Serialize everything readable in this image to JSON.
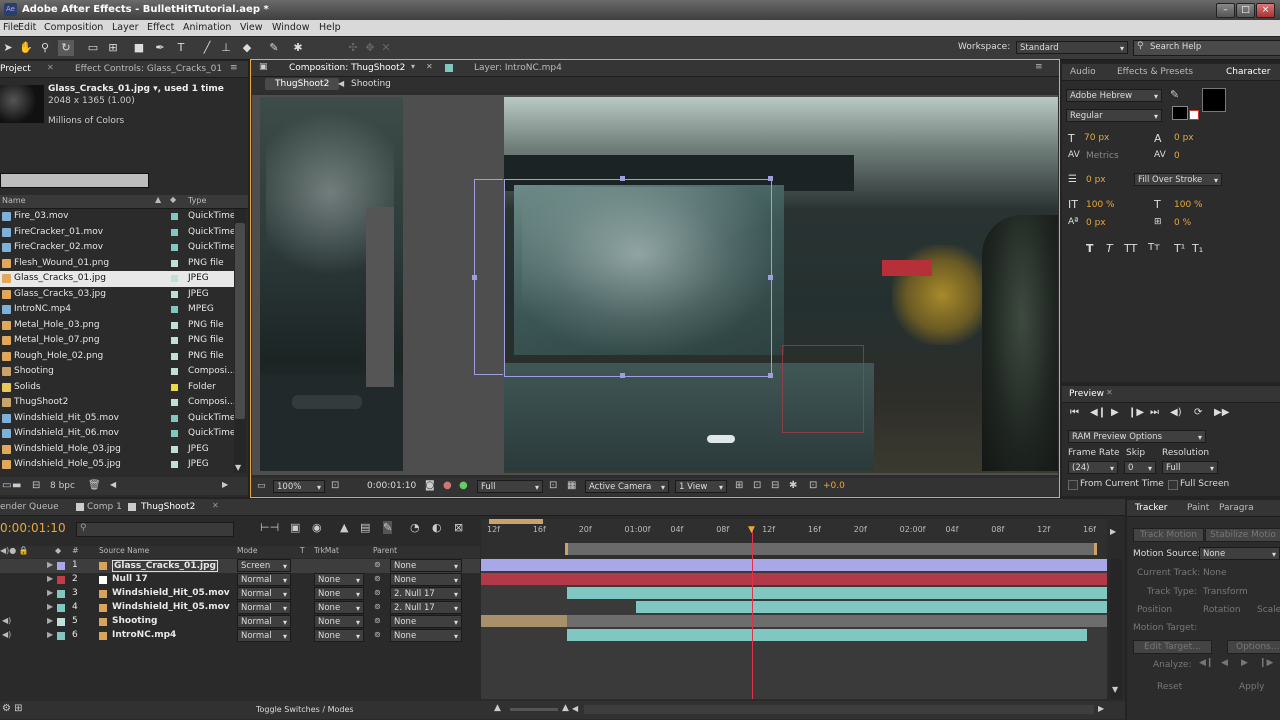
{
  "window": {
    "title": "Adobe After Effects - BulletHitTutorial.aep *"
  },
  "menu": [
    "File",
    "Edit",
    "Composition",
    "Layer",
    "Effect",
    "Animation",
    "View",
    "Window",
    "Help"
  ],
  "toolbar": {
    "workspace_label": "Workspace:",
    "workspace_value": "Standard",
    "search_placeholder": "Search Help"
  },
  "project": {
    "tab_project": "Project",
    "tab_effects": "Effect Controls: Glass_Cracks_01",
    "preview_name": "Glass_Cracks_01.jpg ▾, used 1 time",
    "preview_dims": "2048 x 1365 (1.00)",
    "preview_colors": "Millions of Colors",
    "col_name": "Name",
    "col_type": "Type",
    "items": [
      {
        "name": "Fire_03.mov",
        "type": "QuickTime",
        "color": "#7fc7c0",
        "icon": "#7fb0d8"
      },
      {
        "name": "FireCracker_01.mov",
        "type": "QuickTime",
        "color": "#7fc7c0",
        "icon": "#7fb0d8"
      },
      {
        "name": "FireCracker_02.mov",
        "type": "QuickTime",
        "color": "#7fc7c0",
        "icon": "#7fb0d8"
      },
      {
        "name": "Flesh_Wound_01.png",
        "type": "PNG file",
        "color": "#bfe0da",
        "icon": "#e0a85c"
      },
      {
        "name": "Glass_Cracks_01.jpg",
        "type": "JPEG",
        "color": "#bfe0da",
        "icon": "#e0a85c",
        "selected": true
      },
      {
        "name": "Glass_Cracks_03.jpg",
        "type": "JPEG",
        "color": "#bfe0da",
        "icon": "#e0a85c"
      },
      {
        "name": "IntroNC.mp4",
        "type": "MPEG",
        "color": "#7fc7c0",
        "icon": "#7fb0d8"
      },
      {
        "name": "Metal_Hole_03.png",
        "type": "PNG file",
        "color": "#bfe0da",
        "icon": "#e0a85c"
      },
      {
        "name": "Metal_Hole_07.png",
        "type": "PNG file",
        "color": "#bfe0da",
        "icon": "#e0a85c"
      },
      {
        "name": "Rough_Hole_02.png",
        "type": "PNG file",
        "color": "#bfe0da",
        "icon": "#e0a85c"
      },
      {
        "name": "Shooting",
        "type": "Composi...",
        "color": "#bfe0da",
        "icon": "#c9a36a"
      },
      {
        "name": "Solids",
        "type": "Folder",
        "color": "#e8d84a",
        "icon": "#e8c85a"
      },
      {
        "name": "ThugShoot2",
        "type": "Composi...",
        "color": "#bfe0da",
        "icon": "#c9a36a"
      },
      {
        "name": "Windshield_Hit_05.mov",
        "type": "QuickTime",
        "color": "#7fc7c0",
        "icon": "#7fb0d8"
      },
      {
        "name": "Windshield_Hit_06.mov",
        "type": "QuickTime",
        "color": "#7fc7c0",
        "icon": "#7fb0d8"
      },
      {
        "name": "Windshield_Hole_03.jpg",
        "type": "JPEG",
        "color": "#bfe0da",
        "icon": "#e0a85c"
      },
      {
        "name": "Windshield_Hole_05.jpg",
        "type": "JPEG",
        "color": "#bfe0da",
        "icon": "#e0a85c"
      }
    ],
    "bpc": "8 bpc"
  },
  "comp": {
    "tab_comp": "Composition: ThugShoot2",
    "tab_layer": "Layer: IntroNC.mp4",
    "nav_current": "ThugShoot2",
    "nav_next": "Shooting",
    "zoom": "100%",
    "timecode": "0:00:01:10",
    "resolution": "Full",
    "camera": "Active Camera",
    "view": "1 View",
    "exposure": "+0.0"
  },
  "character": {
    "tab_audio": "Audio",
    "tab_effects": "Effects & Presets",
    "tab_char": "Character",
    "font": "Adobe Hebrew",
    "style": "Regular",
    "size": "70 px",
    "leading": "0 px",
    "kerning": "Metrics",
    "tracking": "0",
    "stroke_width": "0 px",
    "stroke_mode": "Fill Over Stroke",
    "v_scale": "100 %",
    "h_scale": "100 %",
    "baseline": "0 px",
    "tsume": "0 %"
  },
  "preview": {
    "tab": "Preview",
    "ram_options": "RAM Preview Options",
    "frame_rate_label": "Frame Rate",
    "skip_label": "Skip",
    "resolution_label": "Resolution",
    "frame_rate": "(24)",
    "skip": "0",
    "resolution": "Full",
    "from_current": "From Current Time",
    "full_screen": "Full Screen"
  },
  "timeline": {
    "tab_render": "ender Queue",
    "tab_comp1": "Comp 1",
    "tab_thug": "ThugShoot2",
    "timecode": "0:00:01:10",
    "col_source": "Source Name",
    "col_mode": "Mode",
    "col_t": "T",
    "col_trkmat": "TrkMat",
    "col_parent": "Parent",
    "ruler": [
      "12f",
      "16f",
      "20f",
      "01:00f",
      "04f",
      "08f",
      "12f",
      "16f",
      "20f",
      "02:00f",
      "04f",
      "08f",
      "12f",
      "16f"
    ],
    "layers": [
      {
        "num": "1",
        "name": "Glass_Cracks_01.jpg",
        "mode": "Screen",
        "trkmat": "",
        "parent": "None",
        "label": "#a8a8e8"
      },
      {
        "num": "2",
        "name": "Null 17",
        "mode": "Normal",
        "trkmat": "None",
        "parent": "None",
        "label": "#c33c4a"
      },
      {
        "num": "3",
        "name": "Windshield_Hit_05.mov",
        "mode": "Normal",
        "trkmat": "None",
        "parent": "2. Null 17",
        "label": "#7fc7c0"
      },
      {
        "num": "4",
        "name": "Windshield_Hit_05.mov",
        "mode": "Normal",
        "trkmat": "None",
        "parent": "2. Null 17",
        "label": "#7fc7c0"
      },
      {
        "num": "5",
        "name": "Shooting",
        "mode": "Normal",
        "trkmat": "None",
        "parent": "None",
        "label": "#bfe0da"
      },
      {
        "num": "6",
        "name": "IntroNC.mp4",
        "mode": "Normal",
        "trkmat": "None",
        "parent": "None",
        "label": "#7fc7c0"
      }
    ],
    "toggle_label": "Toggle Switches / Modes"
  },
  "tracker": {
    "tab_tracker": "Tracker",
    "tab_paint": "Paint",
    "tab_paragraph": "Paragra",
    "track_motion": "Track Motion",
    "stabilize": "Stabilize Motio",
    "motion_source_label": "Motion Source:",
    "motion_source": "None",
    "current_track_label": "Current Track:",
    "current_track": "None",
    "track_type_label": "Track Type:",
    "track_type": "Transform",
    "position": "Position",
    "rotation": "Rotation",
    "scale": "Scale",
    "motion_target": "Motion Target:",
    "edit_target": "Edit Target...",
    "options": "Options...",
    "analyze": "Analyze:",
    "reset": "Reset",
    "apply": "Apply"
  },
  "colors": {
    "accent": "#e8a83a",
    "playhead": "#e0334a",
    "layer_teal": "#7fc7c0",
    "null_red": "#b23a48",
    "shooting_tan": "#a8906a"
  }
}
